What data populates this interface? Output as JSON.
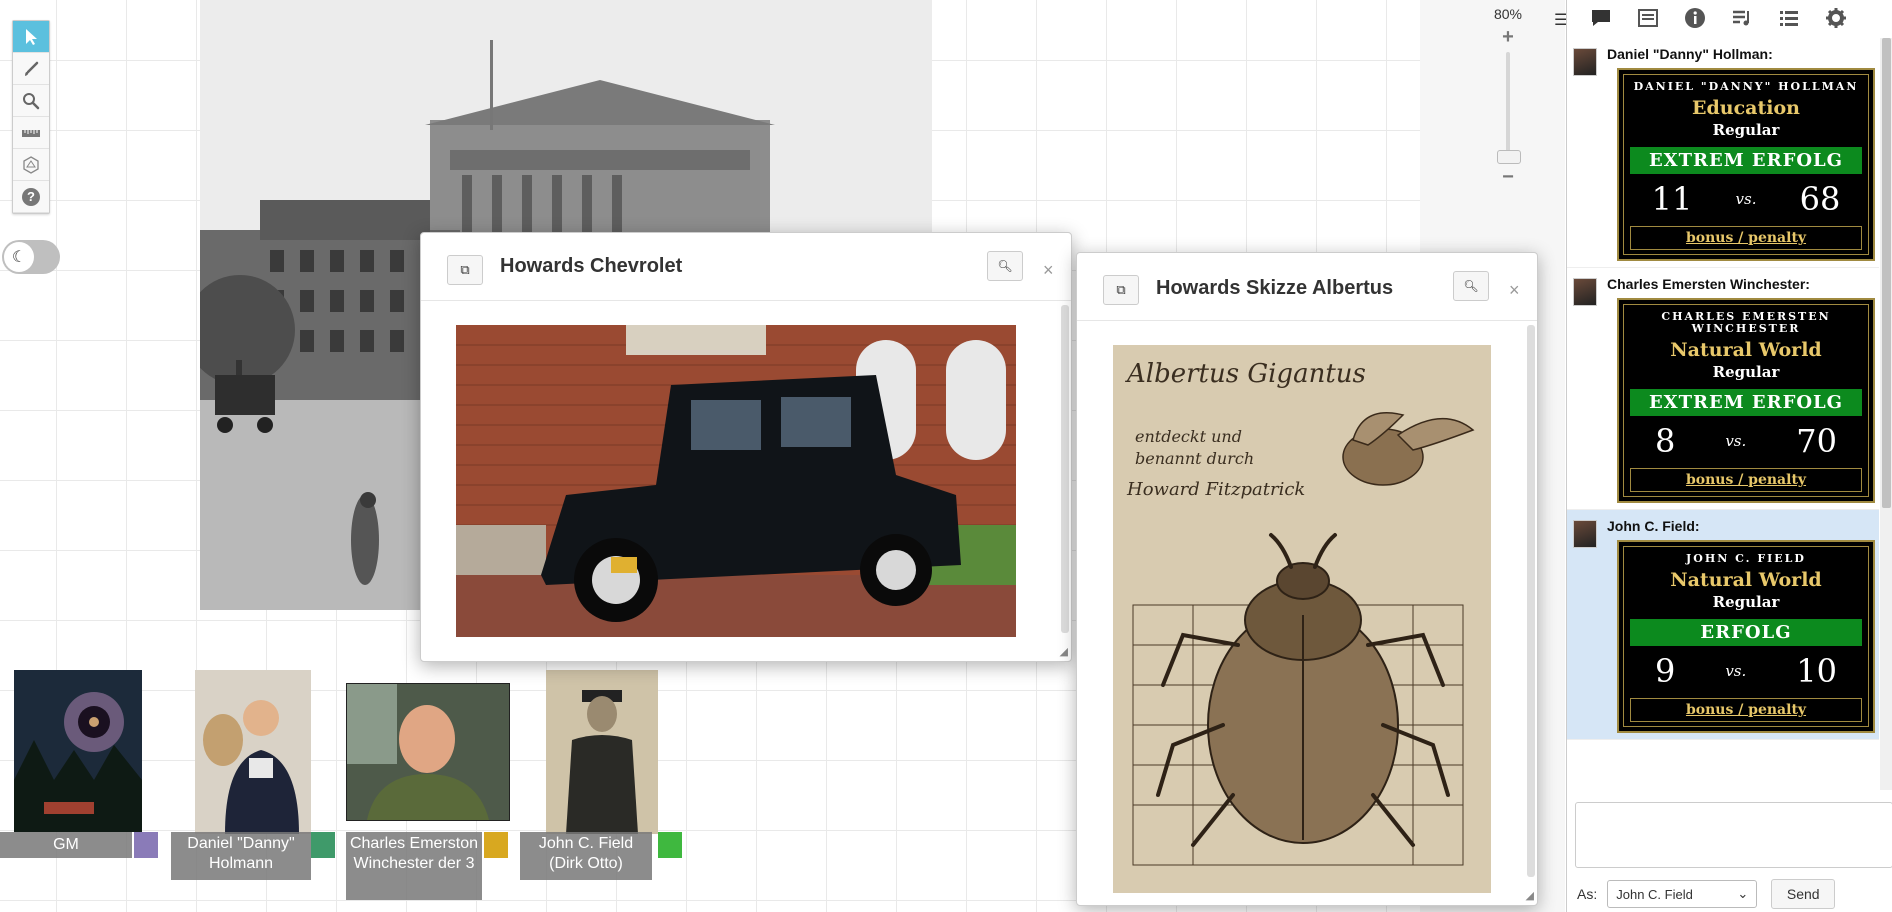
{
  "colors": {
    "accent": "#5bc0de",
    "success": "#0c8a1e",
    "gold": "#e8c86a"
  },
  "toolbar": {
    "tools": [
      "select-arrow-icon",
      "brush-icon",
      "zoom-icon",
      "ruler-icon",
      "dice-icon",
      "help-icon"
    ],
    "help_label": "?",
    "active": "select-arrow-icon"
  },
  "zoom": {
    "level": "80%",
    "plus": "+",
    "minus": "−"
  },
  "handouts": [
    {
      "title": "Howards Chevrolet"
    },
    {
      "title": "Howards Skizze Albertus",
      "sketch_text": [
        "Albertus Gigantus",
        "entdeckt und",
        "benannt durch",
        "Howard Fitzpatrick"
      ]
    }
  ],
  "tokens": [
    {
      "name": "GM",
      "color": "#8a7bb8"
    },
    {
      "name": "Daniel \"Danny\" Holmann",
      "color": "#3f9a6a"
    },
    {
      "name": "Charles Emerston Winchester der 3",
      "color": "#d8a820"
    },
    {
      "name": "John C. Field (Dirk Otto)",
      "color": "#3fb83f"
    }
  ],
  "chat": {
    "tabs": [
      "chat-icon",
      "journal-icon",
      "info-icon",
      "jukebox-icon",
      "list-icon",
      "settings-icon"
    ],
    "messages": [
      {
        "who": "Daniel \"Danny\" Hollman:",
        "roll": {
          "character": "DANIEL \"DANNY\" HOLLMAN",
          "skill": "Education",
          "difficulty": "Regular",
          "result": "EXTREM ERFOLG",
          "roll": "11",
          "vs": "vs.",
          "target": "68",
          "bonus": "bonus / penalty"
        }
      },
      {
        "who": "Charles Emersten Winchester:",
        "roll": {
          "character": "CHARLES EMERSTEN WINCHESTER",
          "skill": "Natural World",
          "difficulty": "Regular",
          "result": "EXTREM ERFOLG",
          "roll": "8",
          "vs": "vs.",
          "target": "70",
          "bonus": "bonus / penalty"
        }
      },
      {
        "who": "John C. Field:",
        "roll": {
          "character": "JOHN C. FIELD",
          "skill": "Natural World",
          "difficulty": "Regular",
          "result": "ERFOLG",
          "roll": "9",
          "vs": "vs.",
          "target": "10",
          "bonus": "bonus / penalty"
        }
      }
    ],
    "as_label": "As:",
    "as_value": "John C. Field",
    "send_label": "Send"
  }
}
